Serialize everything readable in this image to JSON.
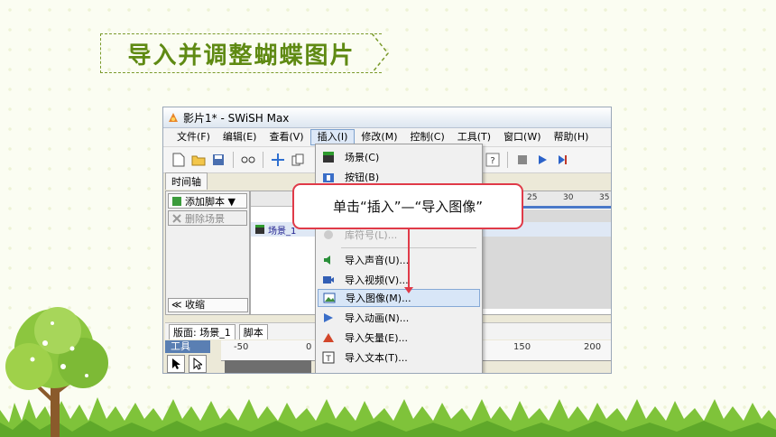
{
  "slide": {
    "title": "导入并调整蝴蝶图片",
    "callout_text": "单击“插入”—“导入图像”",
    "colors": {
      "title": "#5f8a13",
      "callout_border": "#e03a48",
      "highlight": "#d8e6f7"
    }
  },
  "window": {
    "title": "影片1* - SWiSH Max",
    "menus": [
      "文件(F)",
      "编辑(E)",
      "查看(V)",
      "插入(I)",
      "修改(M)",
      "控制(C)",
      "工具(T)",
      "窗口(W)",
      "帮助(H)"
    ],
    "active_menu": "插入(I)"
  },
  "timeline": {
    "tab_label": "时间轴",
    "add_script": "添加脚本 ▼",
    "delete_scene": "删除场景",
    "collapse": "≪ 收缩",
    "scene_label": "场景_1",
    "ruler_numbers": [
      "25",
      "30",
      "35"
    ]
  },
  "stage": {
    "tab_layout": "版面: 场景_1",
    "tab_script": "脚本",
    "tools_label": "工具",
    "ruler_numbers": [
      "-50",
      "0",
      "150",
      "200"
    ]
  },
  "insert_menu": {
    "items": [
      {
        "label": "场景(C)",
        "icon": "scene-icon"
      },
      {
        "label": "按钮(B)",
        "icon": "button-icon"
      },
      {
        "label": "库符号(L)...",
        "icon": "library-icon",
        "faded": true
      },
      {
        "label": "导入声音(U)...",
        "icon": "sound-icon"
      },
      {
        "label": "导入视频(V)...",
        "icon": "video-icon"
      },
      {
        "label": "导入图像(M)...",
        "icon": "image-icon",
        "highlight": true
      },
      {
        "label": "导入动画(N)...",
        "icon": "animation-icon"
      },
      {
        "label": "导入矢量(E)...",
        "icon": "vector-icon"
      },
      {
        "label": "导入文本(T)...",
        "icon": "text-icon"
      }
    ]
  }
}
